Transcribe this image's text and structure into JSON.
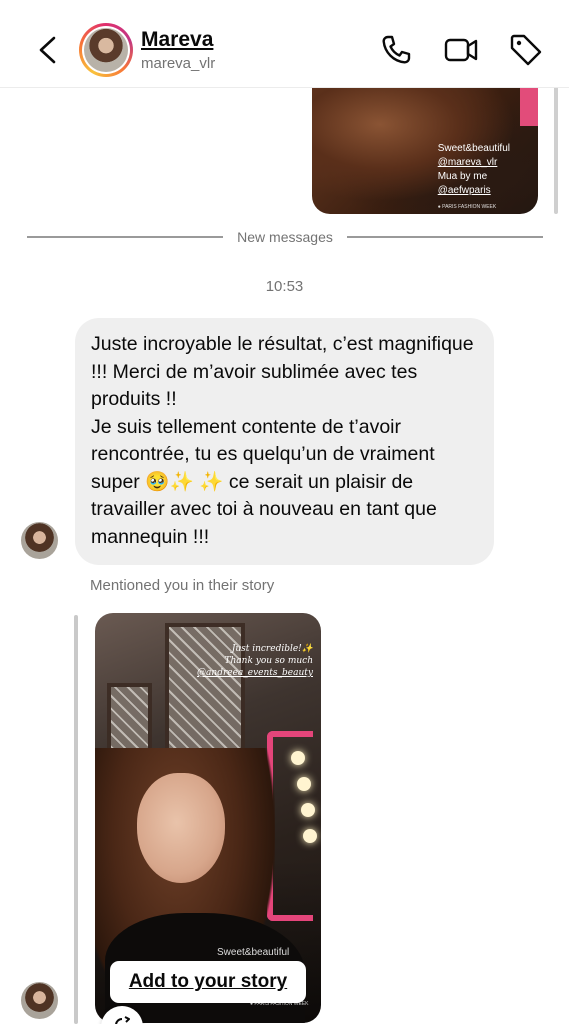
{
  "header": {
    "name": "Mareva",
    "username": "mareva_vlr",
    "icons": [
      "back-icon",
      "phone-icon",
      "video-icon",
      "tag-icon"
    ]
  },
  "top_story": {
    "line1": "Sweet&beautiful",
    "line2": "@mareva_vlr",
    "line3": "Mua by me",
    "line4": "@aefwparis",
    "line5": "● PARIS FASHION WEEK"
  },
  "divider": {
    "label": "New messages"
  },
  "timestamp": "10:53",
  "message": {
    "text": "Juste incroyable le résultat, c’est magnifique !!! Merci de m’avoir sublimée avec tes produits !!\nJe suis tellement contente de t’avoir rencontrée, tu es quelqu’un de vraiment super 🥹✨ ✨ ce serait un plaisir de travailler avec toi à nouveau en tant que mannequin !!!"
  },
  "mention": {
    "label": "Mentioned you in their story"
  },
  "story_card": {
    "overlay1": "Just incredible!✨",
    "overlay2": "Thank you so much",
    "overlay3": "@andreea_events_beauty",
    "sign": "Sweet&beautiful",
    "tiny": "● PARIS FASHION WEEK",
    "button": "Add to your story"
  },
  "colors": {
    "accent_pink": "#e24c7a",
    "bubble_bg": "#efefef",
    "secondary_text": "#737373"
  }
}
